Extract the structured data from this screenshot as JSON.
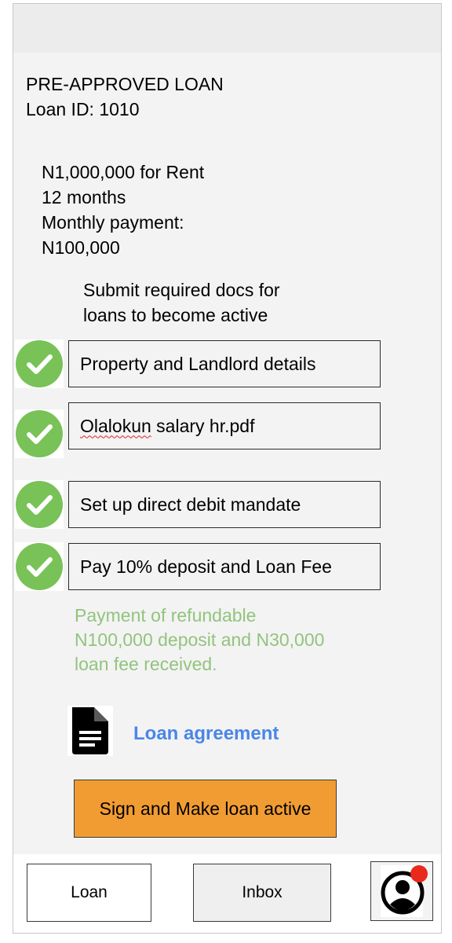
{
  "header": {
    "title": "PRE-APPROVED LOAN",
    "loan_id": "Loan ID: 1010"
  },
  "summary": {
    "amount_purpose": "N1,000,000 for Rent",
    "term": "12 months",
    "monthly_label": "Monthly payment:",
    "monthly_amount": "N100,000"
  },
  "instructions": {
    "line1": "Submit required docs for",
    "line2": "loans to become active"
  },
  "steps": [
    {
      "label": "Property and Landlord details",
      "status": "completed",
      "icon": "check-circle-icon"
    },
    {
      "label": "Olalokun salary hr.pdf",
      "status": "completed",
      "icon": "check-circle-icon"
    },
    {
      "label": "Set up direct debit mandate",
      "status": "completed",
      "icon": "check-circle-icon"
    },
    {
      "label": "Pay 10% deposit and Loan Fee",
      "status": "completed",
      "icon": "check-circle-icon"
    }
  ],
  "payment_note": {
    "line1": "Payment of refundable",
    "line2": "N100,000 deposit and N30,000",
    "line3": "loan fee received."
  },
  "agreement": {
    "icon": "document-icon",
    "label": "Loan agreement"
  },
  "primary_action": {
    "label": "Sign and Make loan active"
  },
  "bottom_nav": {
    "loan_label": "Loan",
    "inbox_label": "Inbox",
    "profile_icon": "user-avatar-icon",
    "notification_badge": "notification-dot"
  },
  "colors": {
    "check_green": "#78c257",
    "note_green": "#92c47d",
    "link_blue": "#4a86e8",
    "action_orange": "#f19c33",
    "badge_red": "#e8291c"
  }
}
